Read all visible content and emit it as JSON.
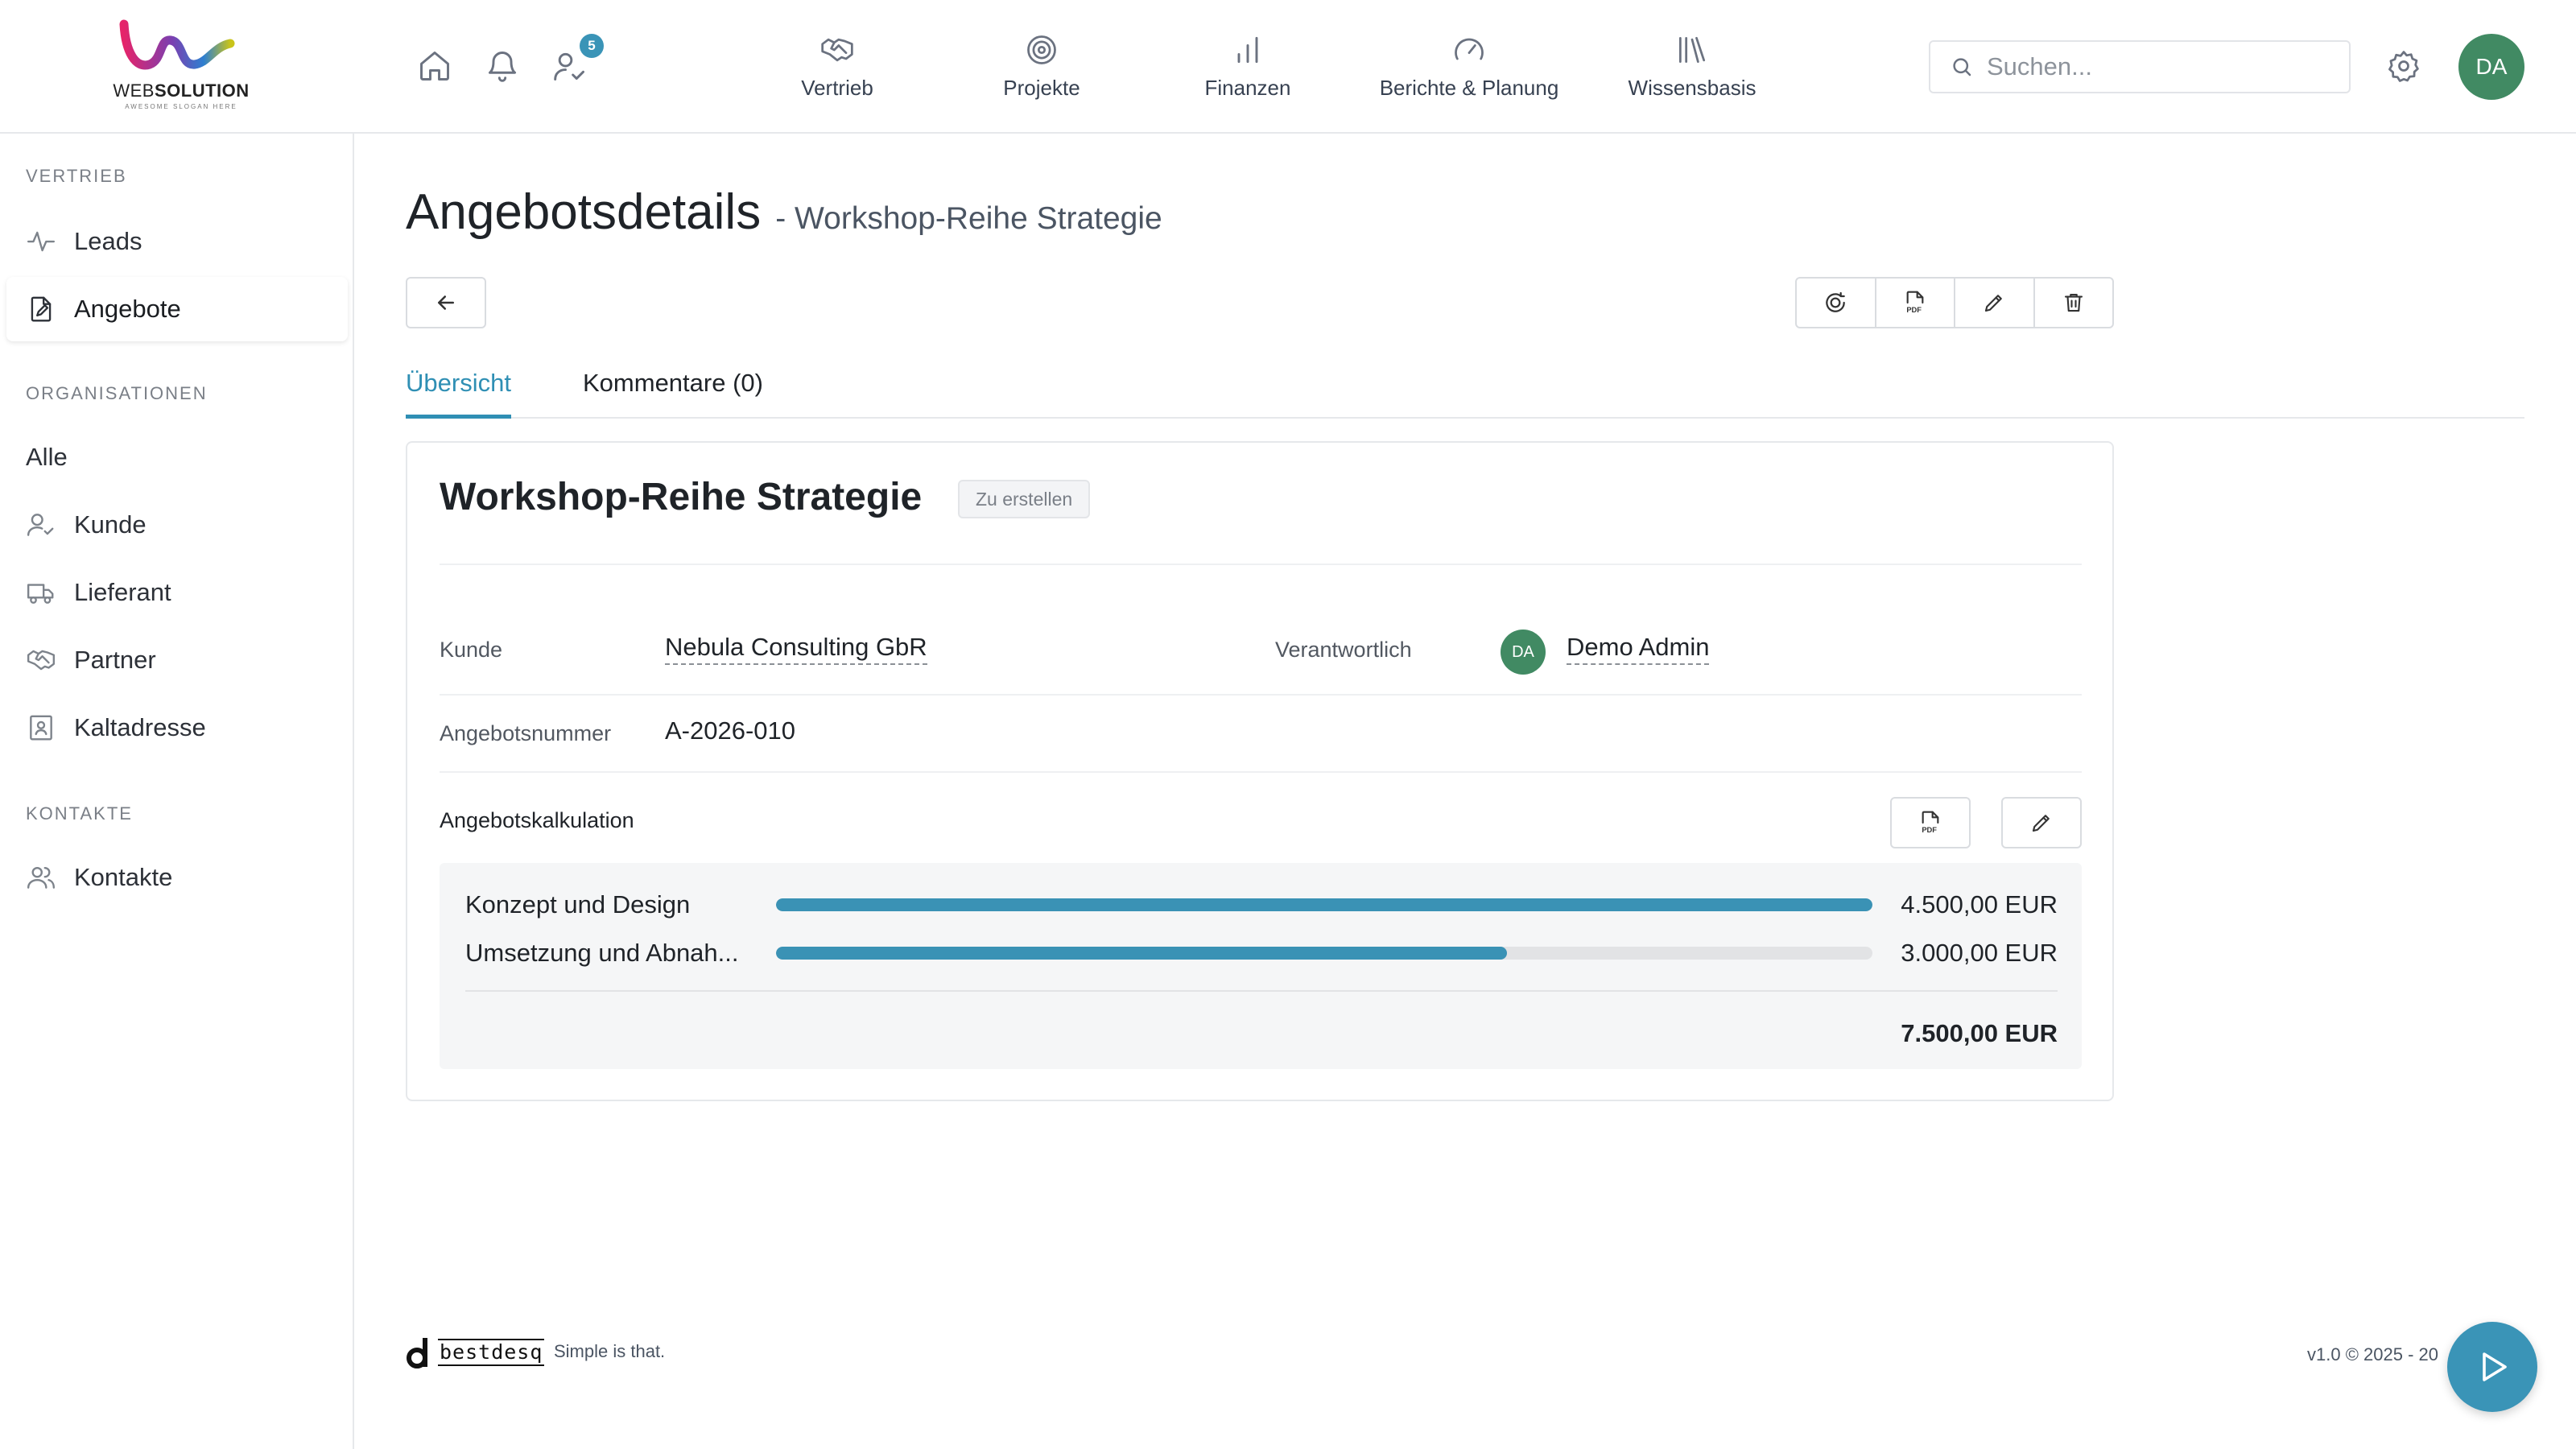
{
  "brand": {
    "logo_main": "WEB",
    "logo_bold": "SOLUTION",
    "logo_tagline": "AWESOME SLOGAN HERE"
  },
  "header": {
    "notification_count": "5",
    "nav": [
      {
        "label": "Vertrieb",
        "icon": "handshake-icon"
      },
      {
        "label": "Projekte",
        "icon": "target-icon"
      },
      {
        "label": "Finanzen",
        "icon": "bar-chart-icon"
      },
      {
        "label": "Berichte & Planung",
        "icon": "gauge-icon"
      },
      {
        "label": "Wissensbasis",
        "icon": "library-icon"
      }
    ],
    "search_placeholder": "Suchen...",
    "user_initials": "DA"
  },
  "sidebar": {
    "sections": [
      {
        "title": "VERTRIEB",
        "items": [
          {
            "label": "Leads",
            "icon": "activity-icon",
            "active": false
          },
          {
            "label": "Angebote",
            "icon": "file-edit-icon",
            "active": true
          }
        ]
      },
      {
        "title": "ORGANISATIONEN",
        "items": [
          {
            "label": "Alle",
            "icon": "",
            "active": false
          },
          {
            "label": "Kunde",
            "icon": "user-check-icon",
            "active": false
          },
          {
            "label": "Lieferant",
            "icon": "truck-icon",
            "active": false
          },
          {
            "label": "Partner",
            "icon": "handshake-icon",
            "active": false
          },
          {
            "label": "Kaltadresse",
            "icon": "contact-card-icon",
            "active": false
          }
        ]
      },
      {
        "title": "KONTAKTE",
        "items": [
          {
            "label": "Kontakte",
            "icon": "users-icon",
            "active": false
          }
        ]
      }
    ]
  },
  "page": {
    "title": "Angebotsdetails",
    "subtitle": "- Workshop-Reihe Strategie"
  },
  "tabs": [
    {
      "label": "Übersicht",
      "active": true
    },
    {
      "label": "Kommentare (0)",
      "active": false
    }
  ],
  "offer": {
    "name": "Workshop-Reihe Strategie",
    "status": "Zu erstellen",
    "customer_label": "Kunde",
    "customer": "Nebula Consulting GbR",
    "responsible_label": "Verantwortlich",
    "responsible_initials": "DA",
    "responsible": "Demo Admin",
    "number_label": "Angebotsnummer",
    "number": "A-2026-010"
  },
  "calculation": {
    "title": "Angebotskalkulation",
    "lines": [
      {
        "name": "Konzept und Design",
        "amount": "4.500,00 EUR",
        "share": 1.0
      },
      {
        "name": "Umsetzung und Abnah...",
        "amount": "3.000,00 EUR",
        "share": 0.667
      }
    ],
    "total": "7.500,00 EUR"
  },
  "footer": {
    "brand": "bestdesq",
    "tagline": "Simple is that.",
    "version": "v1.0 © 2025 - 20"
  },
  "colors": {
    "accent": "#3a94b7",
    "avatar": "#418a63",
    "bar": "#3a92b5"
  }
}
